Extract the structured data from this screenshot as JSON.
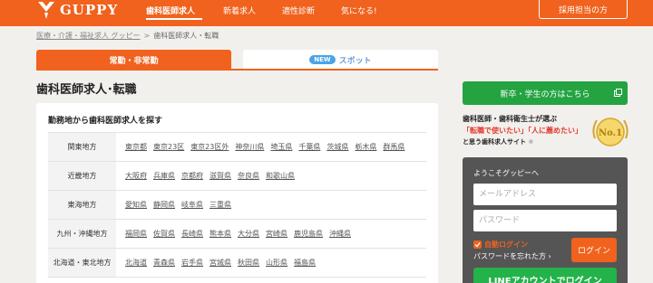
{
  "header": {
    "logo_text": "GUPPY",
    "nav": [
      "歯科医師求人",
      "新着求人",
      "適性診断",
      "気になる!"
    ],
    "recruiter_button": "採用担当の方"
  },
  "breadcrumb": {
    "items": [
      "医療・介護・福祉求人 グッピー",
      "歯科医師求人・転職"
    ],
    "separator": ">"
  },
  "tabs": {
    "part_time": "常勤・非常勤",
    "new_badge": "NEW",
    "spot": "スポット"
  },
  "page_title": "歯科医師求人･転職",
  "search": {
    "heading": "勤務地から歯科医師求人を探す",
    "regions": [
      {
        "name": "関東地方",
        "prefs": [
          "東京都",
          "東京23区",
          "東京23区外",
          "神奈川県",
          "埼玉県",
          "千葉県",
          "茨城県",
          "栃木県",
          "群馬県"
        ]
      },
      {
        "name": "近畿地方",
        "prefs": [
          "大阪府",
          "兵庫県",
          "京都府",
          "滋賀県",
          "奈良県",
          "和歌山県"
        ]
      },
      {
        "name": "東海地方",
        "prefs": [
          "愛知県",
          "静岡県",
          "岐阜県",
          "三重県"
        ]
      },
      {
        "name": "九州・沖縄地方",
        "prefs": [
          "福岡県",
          "佐賀県",
          "長崎県",
          "熊本県",
          "大分県",
          "宮崎県",
          "鹿児島県",
          "沖縄県"
        ]
      },
      {
        "name": "北海道・東北地方",
        "prefs": [
          "北海道",
          "青森県",
          "岩手県",
          "宮城県",
          "秋田県",
          "山形県",
          "福島県"
        ]
      }
    ]
  },
  "sidebar": {
    "newgrad_button": "新卒・学生の方はこちら",
    "promo": {
      "line1": "歯科医師・歯科衛生士が選ぶ",
      "line2": "「転職で使いたい」「人に薦めたい」",
      "line3": "と思う歯科求人サイト",
      "line3_mark": "※",
      "medal": "No.1"
    },
    "login": {
      "welcome": "ようこそグッピーへ",
      "email_placeholder": "メールアドレス",
      "password_placeholder": "パスワード",
      "auto_login": "自動ログイン",
      "forgot": "パスワードを忘れた方",
      "forgot_arrow": "›",
      "login_button": "ログイン",
      "line_button": "LINEアカウントでログイン"
    }
  },
  "colors": {
    "brand_orange": "#f0621d",
    "green": "#23a441",
    "link_blue": "#1d6fc9",
    "promo_red": "#e33a2d"
  }
}
